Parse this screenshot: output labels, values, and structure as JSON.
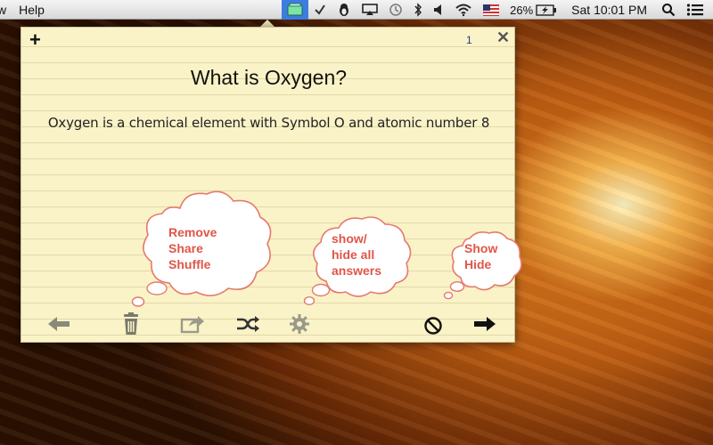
{
  "menubar": {
    "left_items": [
      "w",
      "Help"
    ],
    "battery": "26%",
    "clock": "Sat 10:01 PM",
    "icons": [
      "flashcards-icon",
      "checkmark-icon",
      "penguin-icon",
      "airplay-icon",
      "time-machine-icon",
      "bluetooth-icon",
      "volume-icon",
      "wifi-icon",
      "us-flag-icon",
      "battery-icon",
      "spotlight-icon",
      "notification-list-icon"
    ]
  },
  "card": {
    "add_label": "+",
    "count": "1",
    "close_label": "✕",
    "question": "What is Oxygen?",
    "answer": "Oxygen is a chemical element with Symbol O and atomic number 8"
  },
  "toolbar": {
    "icons": [
      "back-arrow-icon",
      "trash-icon",
      "share-icon",
      "shuffle-icon",
      "gear-icon",
      "hide-answer-icon",
      "forward-arrow-icon"
    ]
  },
  "tips": {
    "remove_share_shuffle": [
      "Remove",
      "Share",
      "Shuffle"
    ],
    "show_hide_all": [
      "show/",
      "hide all",
      "answers"
    ],
    "show_hide": [
      "Show",
      "Hide"
    ]
  },
  "colors": {
    "tip_text": "#e05548",
    "card_paper": "#faf3c8",
    "menu_highlight": "#3d7de0"
  }
}
